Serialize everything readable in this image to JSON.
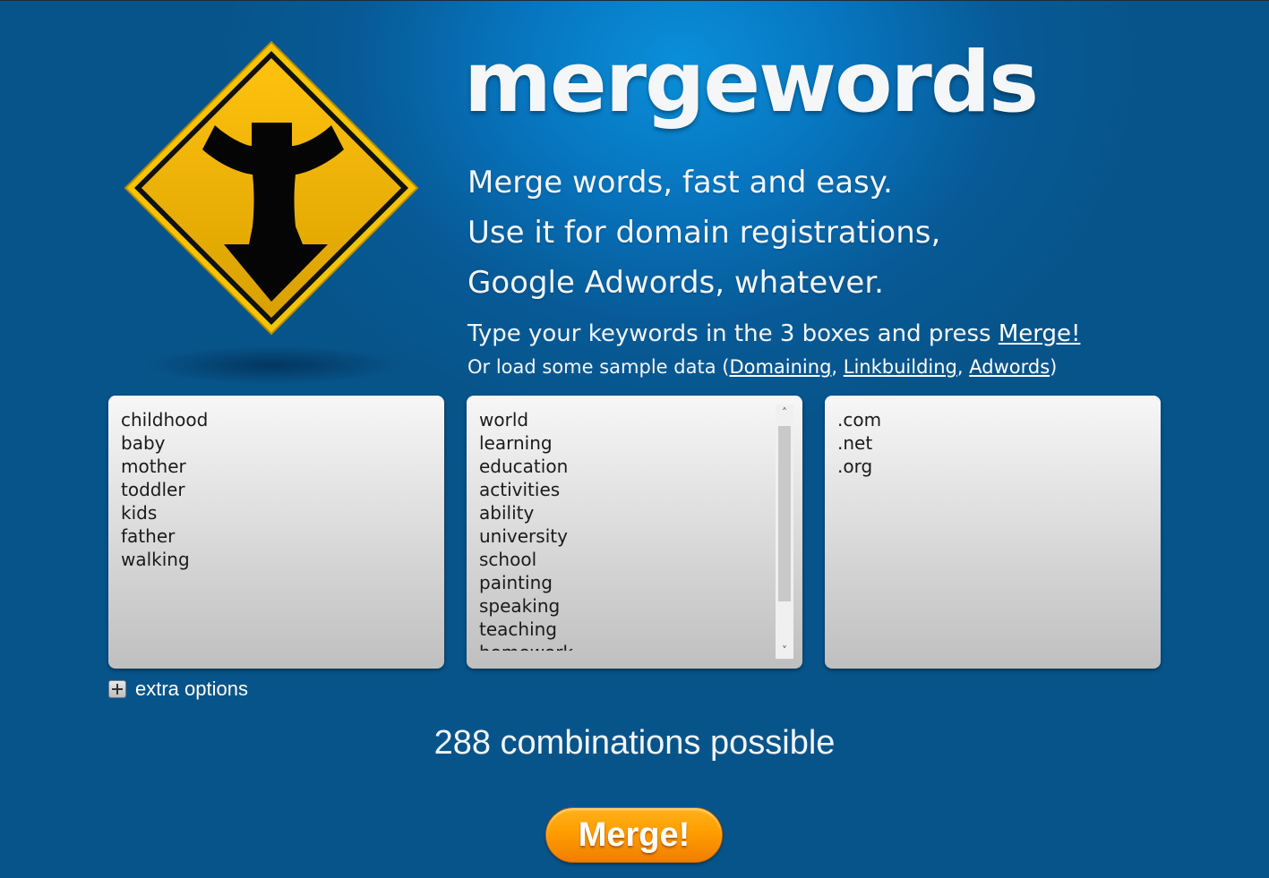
{
  "header": {
    "title": "mergewords",
    "taglines": [
      "Merge words, fast and easy.",
      "Use it for domain registrations,",
      "Google Adwords, whatever."
    ],
    "instruction_prefix": "Type your keywords in the 3 boxes and press ",
    "instruction_link": "Merge!",
    "sample_prefix": "Or load some sample data (",
    "sample_links": [
      "Domaining",
      "Linkbuilding",
      "Adwords"
    ],
    "sample_sep": ", ",
    "sample_suffix": ")"
  },
  "boxes": [
    {
      "words": [
        "childhood",
        "baby",
        "mother",
        "toddler",
        "kids",
        "father",
        "walking"
      ]
    },
    {
      "words": [
        "world",
        "learning",
        "education",
        "activities",
        "ability",
        "university",
        "school",
        "painting",
        "speaking",
        "teaching",
        "homework"
      ]
    },
    {
      "words": [
        ".com",
        ".net",
        ".org"
      ]
    }
  ],
  "extra_options_label": "extra options",
  "combinations_text": "288 combinations possible",
  "merge_button_label": "Merge!",
  "colors": {
    "background": "#07548a",
    "sign_yellow": "#f2b400",
    "button_orange": "#ff9d00"
  },
  "icons": {
    "logo": "merge-road-sign-icon",
    "extra_options": "plus-icon"
  }
}
